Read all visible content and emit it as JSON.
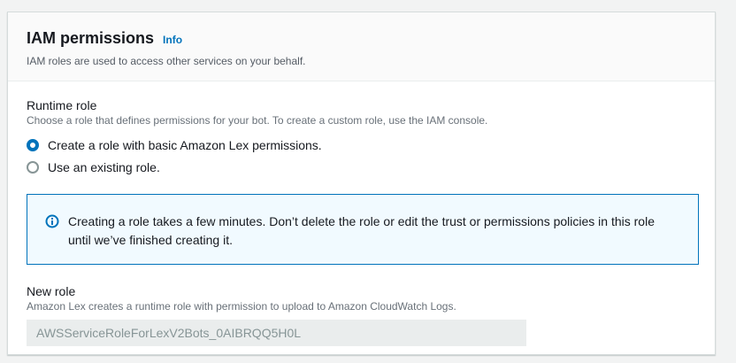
{
  "header": {
    "title": "IAM permissions",
    "info_link": "Info",
    "description": "IAM roles are used to access other services on your behalf."
  },
  "runtime_role": {
    "label": "Runtime role",
    "description": "Choose a role that defines permissions for your bot. To create a custom role, use the IAM console.",
    "options": [
      {
        "label": "Create a role with basic Amazon Lex permissions.",
        "selected": true
      },
      {
        "label": "Use an existing role.",
        "selected": false
      }
    ]
  },
  "alert": {
    "icon": "info-circle-icon",
    "text_line1": "Creating a role takes a few minutes. Don’t delete the role or edit the trust or permissions policies in this role",
    "text_line2": "until we’ve finished creating it."
  },
  "new_role": {
    "label": "New role",
    "description": "Amazon Lex creates a runtime role with permission to upload to Amazon CloudWatch Logs.",
    "value": "AWSServiceRoleForLexV2Bots_0AIBRQQ5H0L",
    "disabled": true
  },
  "colors": {
    "accent": "#0073bb",
    "alert_background": "#f1faff",
    "disabled_input": "#eaeded"
  }
}
